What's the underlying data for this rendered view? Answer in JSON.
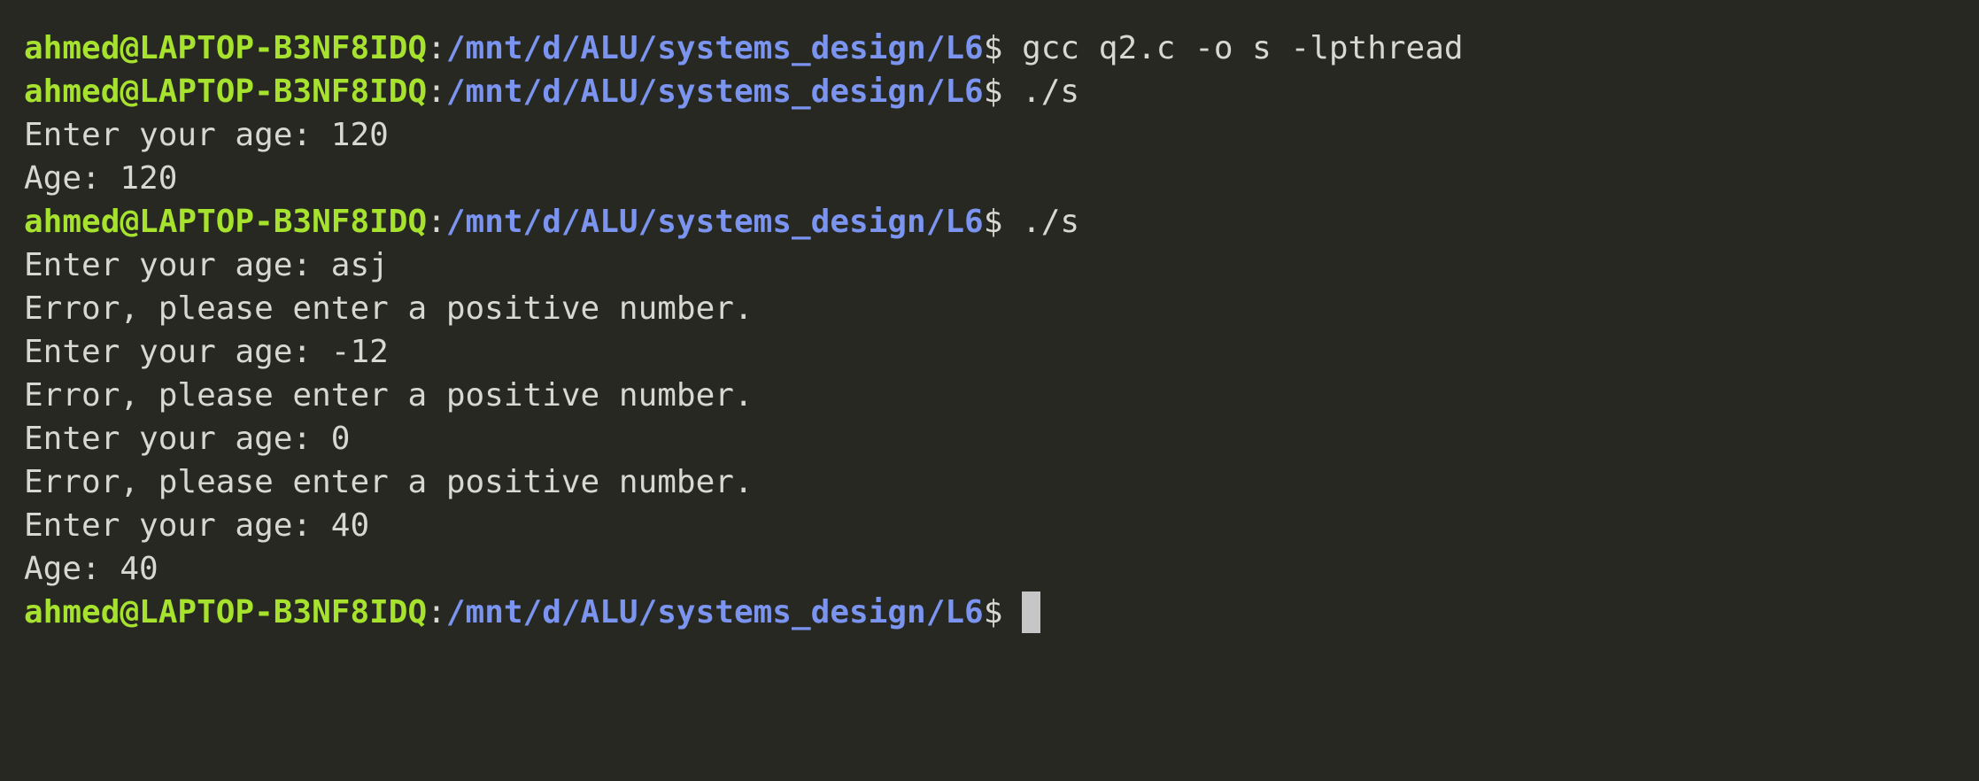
{
  "prompt": {
    "user_host": "ahmed@LAPTOP-B3NF8IDQ",
    "separator": ":",
    "path": "/mnt/d/ALU/systems_design/L6",
    "symbol": "$"
  },
  "lines": [
    {
      "kind": "prompt",
      "command": " gcc q2.c -o s -lpthread"
    },
    {
      "kind": "prompt",
      "command": " ./s"
    },
    {
      "kind": "output",
      "text": "Enter your age: 120"
    },
    {
      "kind": "output",
      "text": "Age: 120"
    },
    {
      "kind": "prompt",
      "command": " ./s"
    },
    {
      "kind": "output",
      "text": "Enter your age: asj"
    },
    {
      "kind": "output",
      "text": "Error, please enter a positive number."
    },
    {
      "kind": "output",
      "text": "Enter your age: -12"
    },
    {
      "kind": "output",
      "text": "Error, please enter a positive number."
    },
    {
      "kind": "output",
      "text": "Enter your age: 0"
    },
    {
      "kind": "output",
      "text": "Error, please enter a positive number."
    },
    {
      "kind": "output",
      "text": "Enter your age: 40"
    },
    {
      "kind": "output",
      "text": "Age: 40"
    },
    {
      "kind": "prompt",
      "command": " ",
      "cursor": true
    }
  ],
  "colors": {
    "background": "#272822",
    "foreground": "#d8d8d2",
    "user_host": "#a6e22e",
    "path": "#7b94f0",
    "cursor": "#c6c6c6"
  }
}
